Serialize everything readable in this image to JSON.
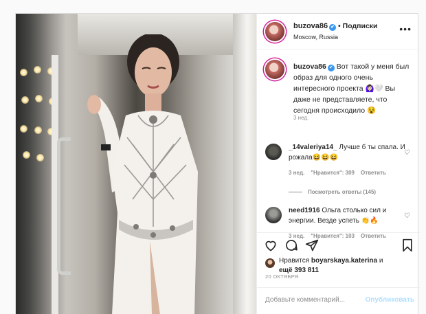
{
  "post": {
    "author": {
      "username": "buzova86",
      "verified_mark": "✔",
      "follow_label": "Подписки",
      "location": "Moscow, Russia"
    },
    "more_icon": "more-horizontal-icon",
    "caption": {
      "username": "buzova86",
      "text": "Вот такой у меня был образ для одного очень интересного проекта 🙆🏻‍♀️🤍 Вы даже не представляете, что сегодня происходило 😵",
      "time": "3 нед."
    },
    "comments": [
      {
        "username": "_14valeriya14_",
        "text": "Лучше б ты спала. И рожала😆😆😆",
        "time": "3 нед.",
        "likes": "\"Нравится\": 309",
        "reply": "Ответить",
        "view_replies": "Посмотреть ответы (145)"
      },
      {
        "username": "need1916",
        "text": "Ольга столько сил и энергии. Везде успеть 👏🔥",
        "time": "3 нед.",
        "likes": "\"Нравится\": 103",
        "reply": "Ответить"
      }
    ],
    "likes": {
      "prefix": "Нравится",
      "user": "boyarskaya.katerina",
      "conj": "и",
      "more": "ещё 393 811"
    },
    "date": "20 ОКТЯБРЯ",
    "add_comment": {
      "placeholder": "Добавьте комментарий...",
      "post_label": "Опубликовать"
    },
    "colors": {
      "accent": "#3897f0",
      "post_disabled": "#b2dffc",
      "muted": "#8e8e8e",
      "text": "#262626"
    }
  }
}
